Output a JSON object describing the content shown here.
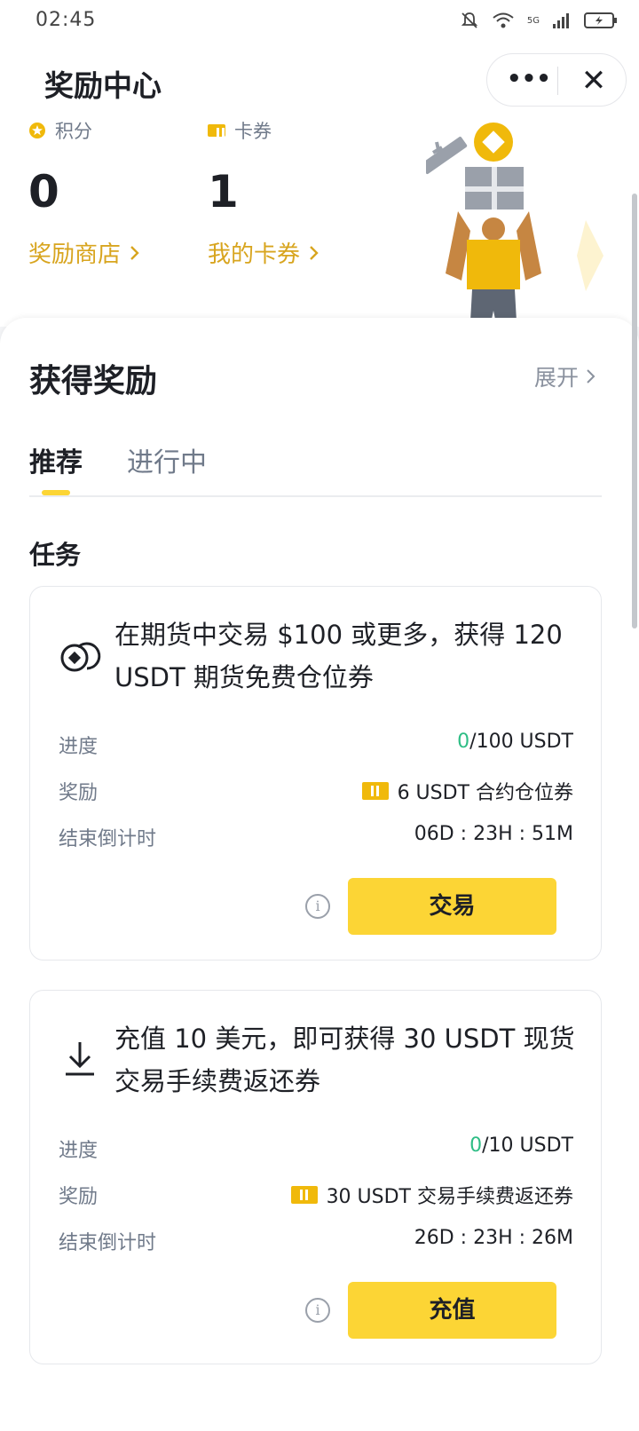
{
  "status_bar": {
    "time": "02:45",
    "network": "5G"
  },
  "header": {
    "title": "奖励中心",
    "more_label": "•••",
    "close_label": "✕"
  },
  "stats": [
    {
      "label": "积分",
      "value": "0",
      "link": "奖励商店",
      "icon": "star-coin-icon"
    },
    {
      "label": "卡券",
      "value": "1",
      "link": "我的卡券",
      "icon": "ticket-icon"
    }
  ],
  "rewards": {
    "title": "获得奖励",
    "expand_label": "展开",
    "tabs": [
      {
        "label": "推荐",
        "active": true
      },
      {
        "label": "进行中",
        "active": false
      }
    ],
    "section_label": "任务",
    "tasks": [
      {
        "icon": "futures-icon",
        "title": "在期货中交易 $100 或更多，获得 120 USDT 期货免费仓位券",
        "progress_label": "进度",
        "progress_current": "0",
        "progress_total": "/100 USDT",
        "reward_label": "奖励",
        "reward_value": "6 USDT 合约仓位券",
        "countdown_label": "结束倒计时",
        "countdown_value": "06D : 23H : 51M",
        "info_label": "i",
        "button_label": "交易"
      },
      {
        "icon": "deposit-icon",
        "title": "充值 10 美元，即可获得 30 USDT 现货交易手续费返还券",
        "progress_label": "进度",
        "progress_current": "0",
        "progress_total": "/10 USDT",
        "reward_label": "奖励",
        "reward_value": "30 USDT 交易手续费返还券",
        "countdown_label": "结束倒计时",
        "countdown_value": "26D : 23H : 26M",
        "info_label": "i",
        "button_label": "充值"
      }
    ]
  },
  "colors": {
    "accent": "#fcd535",
    "link": "#d8a51f",
    "positive": "#2ebd85",
    "muted": "#707a8a"
  }
}
